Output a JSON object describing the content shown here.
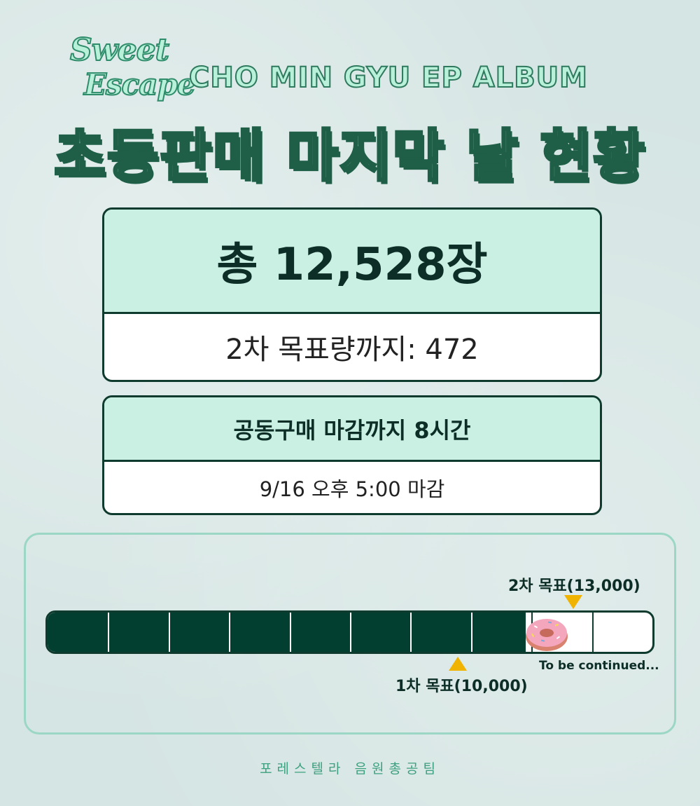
{
  "logo": {
    "line1": "Sweet",
    "line2": "Escape"
  },
  "subtitle": "CHO MIN GYU EP ALBUM",
  "headline": "초동판매 마지막 날 현황",
  "total_box": {
    "total": "총 12,528장",
    "remaining": "2차 목표량까지: 472"
  },
  "deadline_box": {
    "title": "공동구매 마감까지 8시간",
    "detail": "9/16 오후 5:00 마감"
  },
  "progress": {
    "current_value": 12528,
    "fill_fraction": 0.79,
    "segments": 10,
    "goal1_label": "1차 목표(10,000)",
    "goal2_label": "2차 목표(13,000)",
    "continued_label": "To be continued...",
    "colors": {
      "fill": "#033f31",
      "marker": "#f0b400",
      "outline": "#0f3b2e"
    }
  },
  "footer": "포레스텔라 음원총공팀",
  "icons": {
    "donut": "donut-icon",
    "goal_marker_down": "triangle-down-icon",
    "goal_marker_up": "triangle-up-icon"
  }
}
